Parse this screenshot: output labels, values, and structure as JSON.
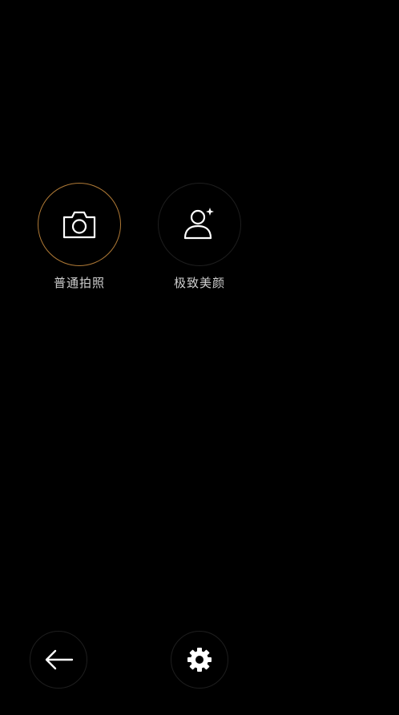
{
  "modes": [
    {
      "label": "普通拍照",
      "icon": "camera-icon",
      "active": true
    },
    {
      "label": "极致美颜",
      "icon": "beauty-portrait-icon",
      "active": false
    }
  ],
  "bottom_bar": {
    "back_icon": "back-arrow-icon",
    "settings_icon": "gear-icon"
  },
  "colors": {
    "background": "#000000",
    "active_ring": "#b07a36",
    "icon": "#ffffff",
    "label": "#cfcfcf"
  }
}
